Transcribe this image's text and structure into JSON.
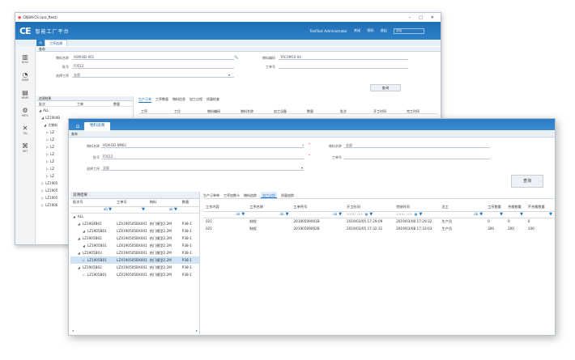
{
  "back": {
    "window_title": "CNSM-CS (ora_ftest)",
    "window_controls": [
      "–",
      "□",
      "✕"
    ],
    "logo": "CE",
    "app_title": "智能工厂平台",
    "user": "TestTest Administrator",
    "header_links": [
      "关闭",
      "密码",
      "退出"
    ],
    "search_placeholder": "搜索",
    "open_tab": "工序追溯",
    "sidenav": [
      {
        "icon": "bar-chart-icon",
        "glyph": "▥",
        "label": "BOD"
      },
      {
        "icon": "gauge-icon",
        "glyph": "◔",
        "label": "SMM"
      },
      {
        "icon": "server-icon",
        "glyph": "▤",
        "label": "WMS"
      },
      {
        "icon": "gear-icon",
        "glyph": "⚙",
        "label": "MES"
      },
      {
        "icon": "tools-icon",
        "glyph": "✕",
        "label": "TAI"
      },
      {
        "icon": "network-icon",
        "glyph": "⌘",
        "label": "SKT"
      }
    ],
    "query_header": "查询",
    "fields": {
      "material_name_label": "物料名称",
      "material_name_value": "HSM-BD-001",
      "material_code_label": "物料编码",
      "material_code_value": "TACOM10-04",
      "batch_label": "批号",
      "batch_value": "F0512",
      "batch_no_label": "工单号",
      "process_label": "选择工序",
      "process_value": "全部"
    },
    "query_button": "查询",
    "tree_header": "追溯结果",
    "tree_columns": [
      "批次",
      "工单",
      "数量"
    ],
    "subtabs": [
      "生产订单",
      "工序数量",
      "物料信息",
      "加工过程",
      "质量检查"
    ],
    "grid_columns": [
      "工序",
      "工位",
      "物料编码",
      "物料名称",
      "加工设备",
      "数量",
      "批次",
      "开工时间",
      "完工时间"
    ],
    "tree": [
      "ALL",
      "LZ1904B",
      "大物料",
      "LZ",
      "LZ",
      "LZ",
      "LZ",
      "LZ",
      "LZ",
      "LZ",
      "LZ1905",
      "LZ1905",
      "LZ1905",
      "LZ1906"
    ]
  },
  "front": {
    "home_glyph": "⌂",
    "open_tab": "物料追溯",
    "query_header": "查询",
    "fields": {
      "material_name_label": "物料名称",
      "material_name_value": "HSM-BD-NMB1",
      "material_code_label": "物料名称",
      "material_code_value": "全部",
      "batch_label": "批号",
      "batch_value": "F0512",
      "order_label": "工单号",
      "process_label": "选择工序",
      "process_value": "全部"
    },
    "query_button": "查询",
    "tree_header": "追溯结果",
    "tree_columns": [
      "批次号",
      "工单号",
      "物料",
      "数量"
    ],
    "tree_rows": [
      {
        "indent": 0,
        "arrow": "◢",
        "lot": "ALL",
        "order": "",
        "material": "",
        "qty": ""
      },
      {
        "indent": 1,
        "arrow": "◢",
        "lot": "LZ1904B01",
        "order": "LZX190505BX001",
        "material": "热门模型2.2M",
        "qty": "P38-1"
      },
      {
        "indent": 2,
        "arrow": "◢",
        "lot": "LZ1905B01",
        "order": "LZX190505BX001",
        "material": "热门模型2.2M",
        "qty": "P38-1"
      },
      {
        "indent": 1,
        "arrow": "◢",
        "lot": "LZ1905B02",
        "order": "LZX190505BX001",
        "material": "热门模型2.2M",
        "qty": "P38-1"
      },
      {
        "indent": 2,
        "arrow": "◢",
        "lot": "LZ1905B01",
        "order": "LZX190505BX001",
        "material": "热门模型2.2M",
        "qty": "P38-1"
      },
      {
        "indent": 1,
        "arrow": "◢",
        "lot": "LZ1905B03",
        "order": "LZX190505BX001",
        "material": "热门模型2.2M",
        "qty": "P38-1"
      },
      {
        "indent": 2,
        "arrow": "▷",
        "lot": "LZ1905B01",
        "order": "LZX190505BX001",
        "material": "热门模型2.2M",
        "qty": "P38-1"
      },
      {
        "indent": 1,
        "arrow": "◢",
        "lot": "LZ1905B02",
        "order": "LZX190505BX001",
        "material": "热门模型2.2M",
        "qty": "P38-1"
      },
      {
        "indent": 2,
        "arrow": "▷",
        "lot": "LZ1905B01",
        "order": "LZX190505BX001",
        "material": "热门模型2.2M",
        "qty": "P38-1"
      }
    ],
    "subtabs": [
      "生产订单单",
      "工序加数卡",
      "物料追踪",
      "加工过程",
      "质量追踪"
    ],
    "active_subtab_index": 3,
    "grid_columns": [
      "工作内容",
      "工序名称",
      "工单序号",
      "开工时间",
      "完结时间",
      "员工",
      "工序数量",
      "合格数量",
      "不合格数量"
    ],
    "date_placeholder": "2019/.../03",
    "grid_rows": [
      {
        "c1": "021",
        "c2": "制程",
        "c3": "20190509001B",
        "c4": "2019/03/05 17:29:09",
        "c5": "2019/03/08 17:29:32",
        "c6": "生产员",
        "c7": "0",
        "c8": "0",
        "c9": "0"
      },
      {
        "c1": "021",
        "c2": "制程",
        "c3": "20190509002B",
        "c4": "2019/03/05 17:32:31",
        "c5": "2019/03/08 17:33:03",
        "c6": "生产员",
        "c7": "300",
        "c8": "200",
        "c9": "100"
      }
    ]
  }
}
